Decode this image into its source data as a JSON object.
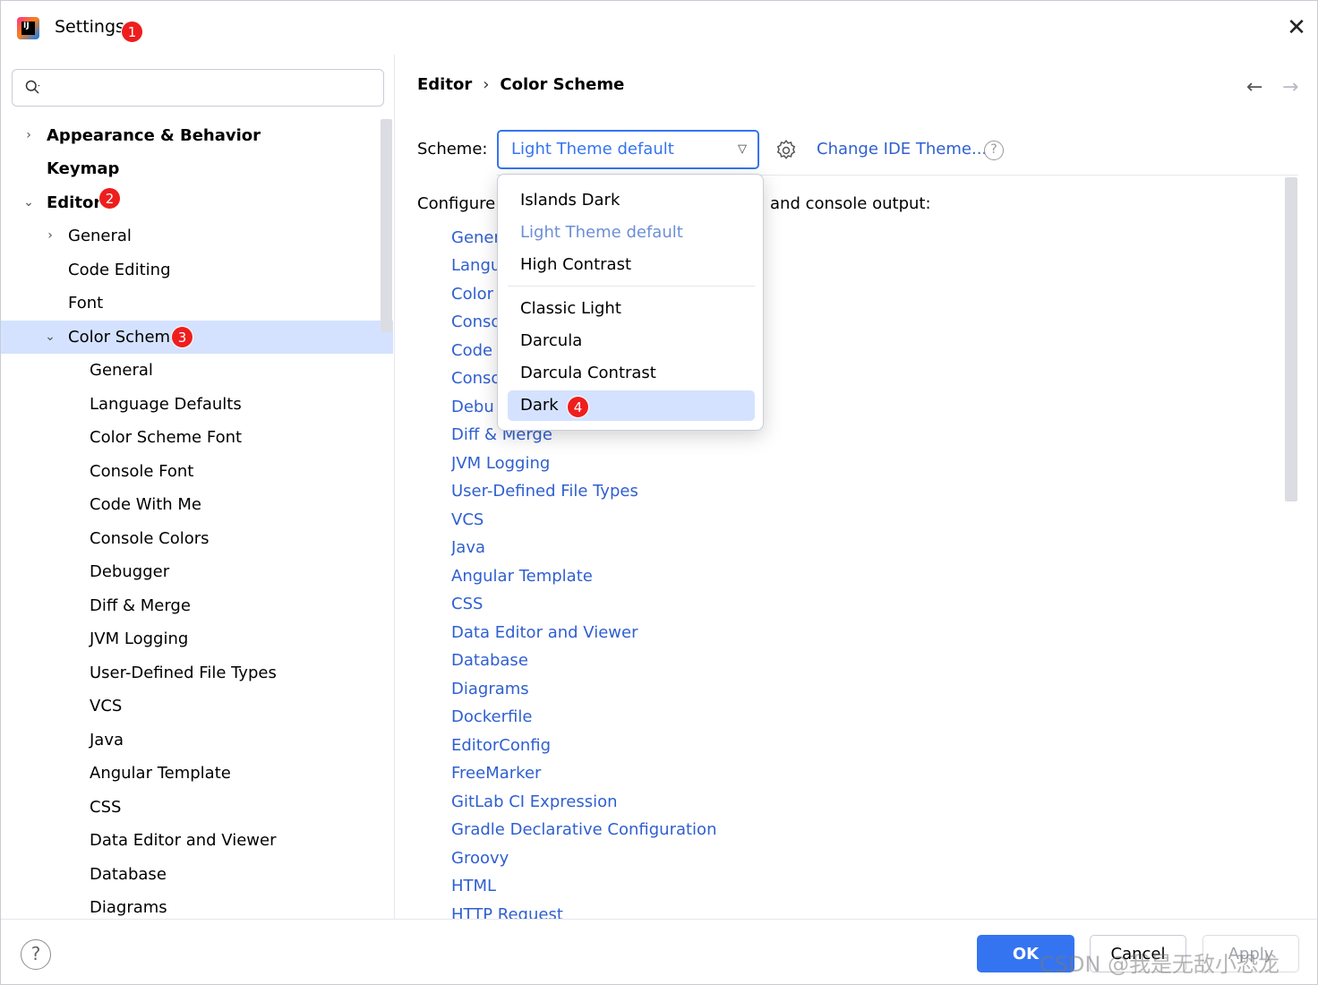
{
  "window": {
    "title": "Settings"
  },
  "badges": {
    "b1": "1",
    "b2": "2",
    "b3": "3",
    "b4": "4"
  },
  "search": {
    "placeholder": ""
  },
  "tree": {
    "appearance": "Appearance & Behavior",
    "keymap": "Keymap",
    "editor": "Editor",
    "general": "General",
    "code_editing": "Code Editing",
    "font": "Font",
    "color_scheme": "Color Scheme",
    "cs_children": [
      "General",
      "Language Defaults",
      "Color Scheme Font",
      "Console Font",
      "Code With Me",
      "Console Colors",
      "Debugger",
      "Diff & Merge",
      "JVM Logging",
      "User-Defined File Types",
      "VCS",
      "Java",
      "Angular Template",
      "CSS",
      "Data Editor and Viewer",
      "Database",
      "Diagrams"
    ]
  },
  "breadcrumb": {
    "parent": "Editor",
    "sep": "›",
    "current": "Color Scheme"
  },
  "nav": {
    "back": "←",
    "forward": "→"
  },
  "scheme": {
    "label": "Scheme:",
    "value": "Light Theme default",
    "change_link": "Change IDE Theme...",
    "help": "?"
  },
  "configure": {
    "prefix": "Configure",
    "suffix": "and console output:"
  },
  "links": [
    "Gener",
    "Langu",
    "Color",
    "Conso",
    "Code",
    "Conso",
    "Debu",
    "Diff & Merge",
    "JVM Logging",
    "User-Defined File Types",
    "VCS",
    "Java",
    "Angular Template",
    "CSS",
    "Data Editor and Viewer",
    "Database",
    "Diagrams",
    "Dockerfile",
    "EditorConfig",
    "FreeMarker",
    "GitLab CI Expression",
    "Gradle Declarative Configuration",
    "Groovy",
    "HTML",
    "HTTP Request"
  ],
  "dropdown": {
    "items": [
      "Islands Dark",
      "Light Theme default",
      "High Contrast",
      "Classic Light",
      "Darcula",
      "Darcula Contrast",
      "Dark"
    ]
  },
  "footer": {
    "help": "?",
    "ok": "OK",
    "cancel": "Cancel",
    "apply": "Apply",
    "watermark": "CSDN @我是无敌小恐龙"
  },
  "colors": {
    "accent": "#3574f0",
    "link": "#2f5fd0",
    "selection": "#d4e2ff",
    "badge": "#ee1e1e"
  },
  "icons": {
    "app": "intellij-logo-icon",
    "close": "close-icon",
    "search": "search-icon",
    "gear": "gear-icon",
    "help": "help-icon",
    "chevron_right": "chevron-right-icon",
    "chevron_down": "chevron-down-icon"
  }
}
